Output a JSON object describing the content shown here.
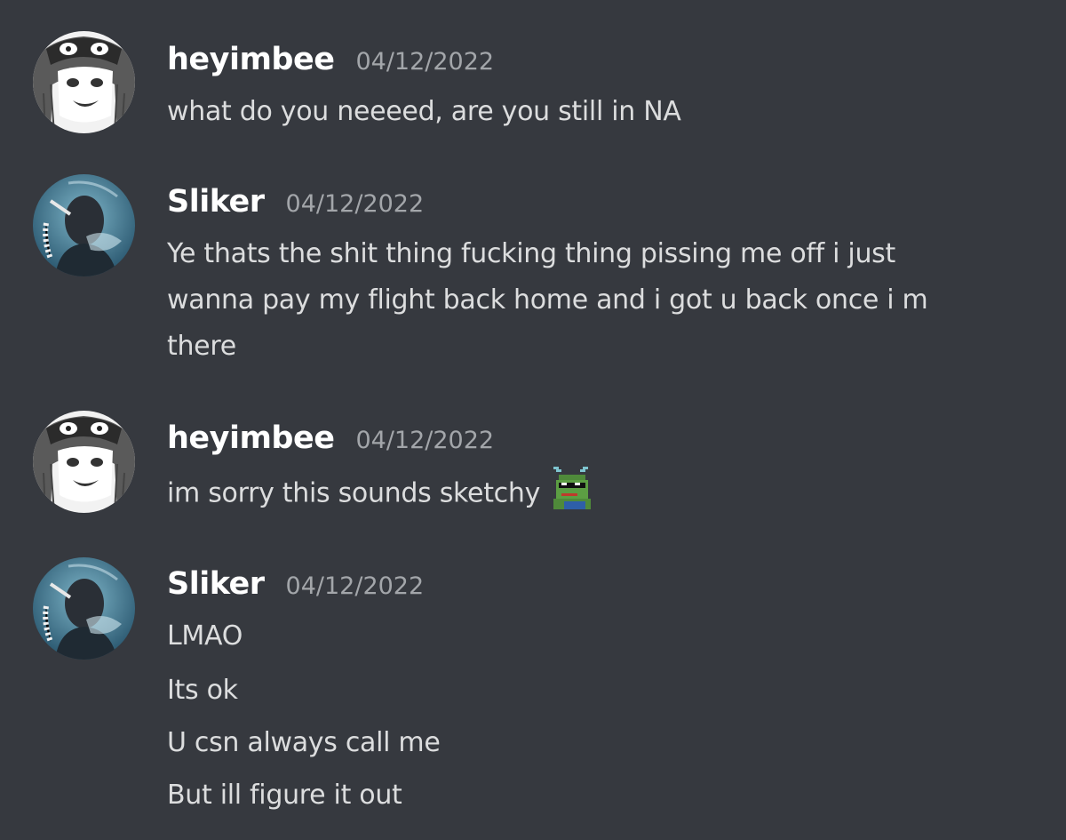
{
  "messages": [
    {
      "author": "heyimbee",
      "timestamp": "04/12/2022",
      "avatar_icon": "manga-girl-avatar-icon",
      "lines": [
        "what do you neeeed, are you still in NA"
      ]
    },
    {
      "author": "Sliker",
      "timestamp": "04/12/2022",
      "avatar_icon": "smoking-man-avatar-icon",
      "lines": [
        "Ye thats the shit thing fucking thing pissing me off i just",
        "wanna pay my flight back home and i got u back once i m",
        "there"
      ]
    },
    {
      "author": "heyimbee",
      "timestamp": "04/12/2022",
      "avatar_icon": "manga-girl-avatar-icon",
      "lines": [
        "im sorry this sounds sketchy"
      ],
      "emoji": "pixel-pepe-sunglasses-emoji-icon"
    },
    {
      "author": "Sliker",
      "timestamp": "04/12/2022",
      "avatar_icon": "smoking-man-avatar-icon",
      "lines": [
        "LMAO",
        "Its ok",
        "U csn always call me",
        "But ill figure it out"
      ]
    }
  ],
  "colors": {
    "background": "#36393f",
    "username": "#ffffff",
    "timestamp": "#a3a6aa",
    "message_text": "#dcddde"
  }
}
